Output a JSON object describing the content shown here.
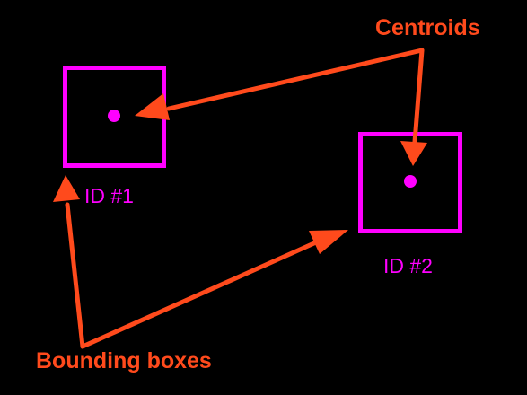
{
  "objects": [
    {
      "id_label": "ID #1"
    },
    {
      "id_label": "ID #2"
    }
  ],
  "callouts": {
    "centroids": "Centroids",
    "bounding_boxes": "Bounding boxes"
  },
  "colors": {
    "background": "#000000",
    "object": "#ff00ff",
    "annotation": "#ff4a1c"
  }
}
